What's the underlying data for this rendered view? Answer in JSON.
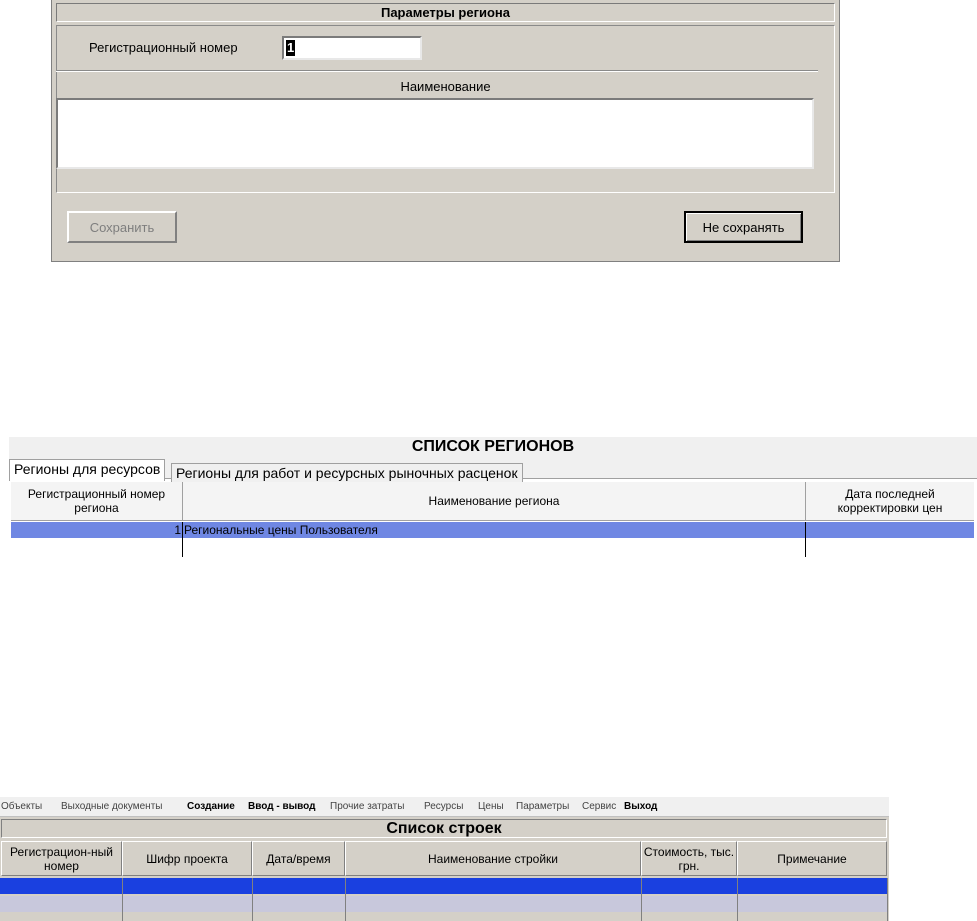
{
  "region_params_dialog": {
    "title": "Параметры региона",
    "reg_number_label": "Регистрационный номер",
    "reg_number_value": "1",
    "name_label": "Наименование",
    "name_value": "",
    "save_button": "Сохранить",
    "dont_save_button": "Не сохранять"
  },
  "region_list": {
    "title": "СПИСОК РЕГИОНОВ",
    "tabs": [
      {
        "label": "Регионы для ресурсов",
        "active": true
      },
      {
        "label": "Регионы для работ и ресурсных рыночных расценок",
        "active": false
      }
    ],
    "columns": [
      "Регистрационный номер региона",
      "Наименование региона",
      "Дата последней корректировки цен"
    ],
    "rows": [
      {
        "reg_number": "1",
        "name": "Региональные цены Пользователя",
        "date": "",
        "selected": true
      }
    ],
    "selection_color": "#6f87e3"
  },
  "construction_list": {
    "menu": [
      {
        "label": "Объекты",
        "bold": false
      },
      {
        "label": "Выходные документы",
        "bold": false
      },
      {
        "label": "Создание",
        "bold": true
      },
      {
        "label": "Ввод - вывод",
        "bold": true
      },
      {
        "label": "Прочие затраты",
        "bold": false
      },
      {
        "label": "Ресурсы",
        "bold": false
      },
      {
        "label": "Цены",
        "bold": false
      },
      {
        "label": "Параметры",
        "bold": false
      },
      {
        "label": "Сервис",
        "bold": false
      },
      {
        "label": "Выход",
        "bold": true
      }
    ],
    "title": "Список строек",
    "columns": [
      "Регистрацион-ный номер",
      "Шифр проекта",
      "Дата/время",
      "Наименование стройки",
      "Стоимость, тыс. грн.",
      "Примечание"
    ],
    "selection_color": "#1a40e0"
  }
}
